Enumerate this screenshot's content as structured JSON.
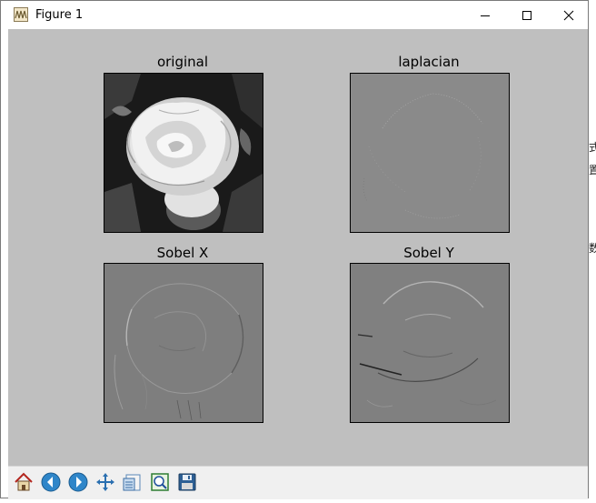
{
  "window": {
    "title": "Figure 1",
    "controls": {
      "minimize": "minimize-icon",
      "maximize": "maximize-icon",
      "close": "close-icon"
    }
  },
  "figure": {
    "subplots": [
      {
        "title": "original"
      },
      {
        "title": "laplacian"
      },
      {
        "title": "Sobel X"
      },
      {
        "title": "Sobel Y"
      }
    ],
    "canvas_color": "#bfbfbf"
  },
  "toolbar": {
    "buttons": [
      "home-icon",
      "back-icon",
      "forward-icon",
      "pan-icon",
      "configure-subplots-icon",
      "zoom-icon",
      "save-icon"
    ]
  },
  "backdrop": {
    "partial_glyphs": [
      "式",
      "置",
      "数",
      "b"
    ]
  }
}
